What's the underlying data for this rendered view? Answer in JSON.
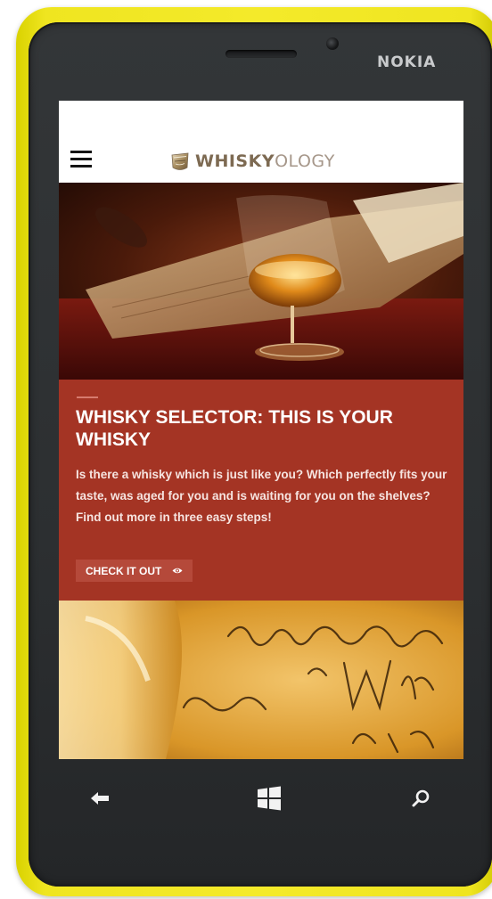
{
  "device": {
    "brand": "NOKIA",
    "body_color": "#f2e82a",
    "face_color": "#2c2f31"
  },
  "site": {
    "logo_bold": "WHISKY",
    "logo_light": "OLOGY",
    "menu_icon": "hamburger-menu-icon"
  },
  "hero": {
    "image_subject": "whisky glass on book"
  },
  "feature": {
    "title": "WHISKY SELECTOR: THIS IS YOUR WHISKY",
    "text": "Is there a whisky which is just like you? Which perfectly fits your taste, was aged for you and is waiting for you on the shelves? Find out more in three easy steps!",
    "button_label": "CHECK IT OUT",
    "button_icon": "eye-icon",
    "card_color": "#a43424"
  },
  "second_image": {
    "image_subject": "handwritten letter with bottle"
  },
  "nav_bar": {
    "back_icon": "back-arrow-icon",
    "start_icon": "windows-logo-icon",
    "search_icon": "search-icon"
  }
}
